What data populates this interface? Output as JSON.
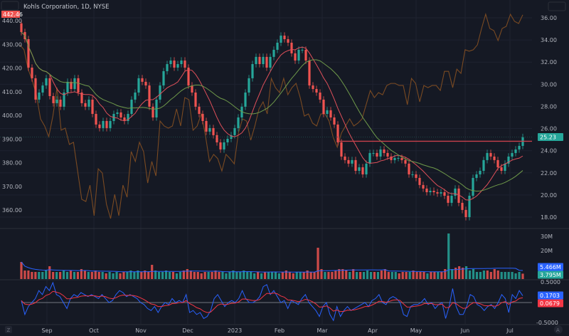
{
  "header": {
    "title": "Kohls Corporation, 1D, NYSE"
  },
  "colors": {
    "background": "#151924",
    "grid": "#1e2230",
    "up": "#26a69a",
    "down": "#ef5350",
    "ma_fast": "#e0505a",
    "ma_slow": "#6f9a4a",
    "compare": "#7a4a22",
    "resistance": "#c8414b",
    "vol_ma": "#2962ff",
    "osc_fast": "#2962ff",
    "osc_slow": "#f23645",
    "zero": "#9598a1"
  },
  "tags": {
    "compare_last": "442.46",
    "price_last": "25.23",
    "vol_ma_last": "5.466M",
    "vol_last": "3.795M",
    "osc_fast_last": "0.1703",
    "osc_slow_last": "0.0679"
  },
  "buttons": {
    "bottom_left": "Z",
    "bottom_right": "A"
  },
  "chart_data": {
    "type": "candlestick",
    "title": "Kohls Corporation, 1D, NYSE",
    "x_tick_labels": [
      "Sep",
      "Oct",
      "Nov",
      "Dec",
      "2023",
      "Feb",
      "Mar",
      "Apr",
      "May",
      "Jun",
      "Jul"
    ],
    "right_axis": {
      "ticks": [
        "36.00",
        "34.00",
        "32.00",
        "30.00",
        "28.00",
        "26.00",
        "24.00",
        "22.00",
        "20.00",
        "18.00"
      ],
      "range": [
        18,
        36
      ]
    },
    "left_axis": {
      "ticks": [
        "440.00",
        "430.00",
        "420.00",
        "410.00",
        "400.00",
        "390.00",
        "380.00",
        "370.00",
        "360.00"
      ],
      "range": [
        360,
        440
      ]
    },
    "closes": [
      34.71,
      34.07,
      31.5,
      30.54,
      28.61,
      29.25,
      29.89,
      30.54,
      28.93,
      28.29,
      28.61,
      27.97,
      29.25,
      30.22,
      29.57,
      30.54,
      29.25,
      28.29,
      27.97,
      28.61,
      27.32,
      26.36,
      26.04,
      26.68,
      26.04,
      26.68,
      27.32,
      27.45,
      27.0,
      26.68,
      27.32,
      28.61,
      29.25,
      30.54,
      30.22,
      29.89,
      27.97,
      27.0,
      28.61,
      29.89,
      31.18,
      31.82,
      32.14,
      31.5,
      31.82,
      32.14,
      31.5,
      29.89,
      29.25,
      27.97,
      27.32,
      26.68,
      25.72,
      26.04,
      25.4,
      24.75,
      24.11,
      24.75,
      25.07,
      25.4,
      26.04,
      27.0,
      27.97,
      29.25,
      30.54,
      31.82,
      32.47,
      31.82,
      32.47,
      31.5,
      32.47,
      33.11,
      33.75,
      34.39,
      34.07,
      33.75,
      32.79,
      32.14,
      33.11,
      33.11,
      32.14,
      29.89,
      29.57,
      29.25,
      28.61,
      27.32,
      27.65,
      27.0,
      26.36,
      24.75,
      23.47,
      23.15,
      22.83,
      23.15,
      22.18,
      22.5,
      21.86,
      22.83,
      23.79,
      23.79,
      23.47,
      24.11,
      23.79,
      23.47,
      23.15,
      23.34,
      23.34,
      23.15,
      22.83,
      21.86,
      21.86,
      21.54,
      20.9,
      20.58,
      20.25,
      20.38,
      20.25,
      20.13,
      20.25,
      19.93,
      19.29,
      19.93,
      20.58,
      19.29,
      18.65,
      18.0,
      19.93,
      21.54,
      21.86,
      22.18,
      23.15,
      23.79,
      23.47,
      23.15,
      22.5,
      22.18,
      22.83,
      23.47,
      23.79,
      24.11,
      24.43,
      25.23
    ],
    "resistance_level": 24.85,
    "compare_series": [
      429.8,
      427.7,
      419.5,
      414.7,
      408.7,
      398.5,
      395.5,
      391.0,
      399.7,
      411.7,
      393.7,
      394.6,
      387.7,
      388.6,
      376.5,
      364.5,
      363.6,
      370.5,
      357.6,
      377.4,
      375.6,
      362.4,
      356.4,
      366.6,
      357.6,
      370.5,
      365.4,
      384.7,
      380.5,
      388.6,
      384.7,
      371.4,
      380.5,
      374.4,
      397.6,
      395.5,
      394.6,
      395.5,
      402.7,
      395.5,
      407.5,
      406.6,
      393.7,
      395.5,
      400.6,
      391.6,
      380.5,
      383.5,
      381.7,
      376.5,
      383.5,
      381.7,
      379.5,
      392.5,
      398.5,
      397.6,
      389.5,
      395.5,
      402.7,
      405.7,
      400.6,
      415.6,
      411.7,
      409.6,
      415.6,
      408.7,
      411.7,
      413.5,
      407.5,
      399.7,
      400.6,
      396.7,
      395.5,
      400.6,
      400.6,
      397.6,
      390.7,
      386.5,
      392.5,
      395.5,
      398.5,
      395.5,
      396.7,
      398.5,
      404.5,
      410.5,
      407.5,
      409.6,
      408.7,
      412.6,
      413.5,
      413.5,
      412.6,
      412.6,
      404.5,
      415.6,
      413.5,
      405.7,
      412.6,
      411.7,
      412.6,
      412.6,
      410.5,
      418.6,
      418.6,
      411.7,
      419.5,
      417.7,
      427.7,
      427.1,
      427.7,
      429.8,
      436.7,
      442.7,
      436.7,
      435.8,
      431.6,
      436.7,
      437.6,
      442.7,
      439.7,
      438.8,
      442.46
    ],
    "volume": {
      "ticks": [
        "30M",
        "20M"
      ],
      "unit": "M",
      "values": [
        12,
        6,
        6,
        5,
        5,
        5,
        5,
        6,
        9,
        5,
        5,
        5,
        6,
        5,
        6,
        5,
        5,
        7,
        6,
        5,
        5,
        6,
        5,
        5,
        4,
        5,
        4,
        5,
        4,
        5,
        5,
        6,
        5,
        6,
        5,
        6,
        5,
        10,
        6,
        5,
        5,
        6,
        5,
        5,
        4,
        5,
        6,
        7,
        6,
        5,
        5,
        4,
        5,
        5,
        5,
        6,
        5,
        5,
        4,
        5,
        6,
        5,
        5,
        6,
        5,
        5,
        4,
        5,
        4,
        5,
        5,
        5,
        5,
        4,
        5,
        6,
        5,
        4,
        5,
        5,
        5,
        6,
        5,
        5,
        22,
        7,
        5,
        5,
        5,
        6,
        7,
        7,
        6,
        5,
        7,
        5,
        5,
        5,
        6,
        5,
        5,
        5,
        6,
        7,
        5,
        5,
        5,
        4,
        5,
        5,
        5,
        6,
        5,
        5,
        5,
        4,
        5,
        5,
        5,
        5,
        7,
        32,
        7,
        8,
        9,
        8,
        9,
        6,
        7,
        5,
        5,
        6,
        6,
        5,
        7,
        6,
        5,
        5,
        5,
        5,
        4,
        5,
        3.795
      ]
    },
    "oscillator": {
      "ticks": [
        "0.5000",
        "-0.5000"
      ],
      "range": [
        -0.5,
        0.5
      ],
      "values": [
        0.05,
        -0.3,
        -0.1,
        0.0,
        0.1,
        0.3,
        0.2,
        0.4,
        0.3,
        0.5,
        0.2,
        0.15,
        0.0,
        -0.15,
        0.1,
        0.2,
        0.15,
        0.25,
        0.2,
        0.15,
        0.2,
        0.15,
        0.1,
        0.2,
        0.1,
        0.0,
        0.05,
        0.2,
        0.3,
        0.25,
        0.15,
        0.2,
        0.15,
        0.1,
        0.0,
        -0.05,
        -0.15,
        -0.2,
        -0.1,
        -0.25,
        -0.1,
        0.0,
        -0.05,
        0.1,
        0.0,
        0.05,
        0.0,
        0.2,
        -0.25,
        -0.2,
        -0.3,
        -0.25,
        -0.4,
        -0.35,
        -0.2,
        0.1,
        0.2,
        0.05,
        -0.1,
        0.0,
        0.05,
        0.0,
        0.1,
        0.3,
        0.1,
        0.0,
        0.0,
        0.05,
        0.15,
        0.4,
        0.45,
        0.2,
        0.3,
        0.15,
        0.0,
        0.05,
        -0.15,
        0.05,
        0.0,
        -0.05,
        0.1,
        0.2,
        0.0,
        -0.1,
        -0.2,
        -0.35,
        -0.1,
        0.0,
        -0.3,
        -0.45,
        -0.1,
        -0.35,
        -0.2,
        -0.1,
        -0.2,
        -0.15,
        -0.1,
        -0.05,
        0.0,
        -0.1,
        0.05,
        0.1,
        0.2,
        0.0,
        -0.05,
        0.1,
        0.15,
        0.1,
        0.0,
        -0.3,
        -0.35,
        -0.1,
        -0.05,
        -0.05,
        0.0,
        0.1,
        -0.05,
        0.0,
        -0.15,
        -0.05,
        0.0,
        -0.4,
        -0.1,
        0.35,
        -0.1,
        -0.3,
        -0.3,
        -0.1,
        0.2,
        0.15,
        -0.05,
        -0.1,
        -0.2,
        -0.1,
        -0.05,
        -0.15,
        0.0,
        0.2,
        0.1,
        -0.25,
        0.2,
        0.1,
        0.3,
        0.1703
      ]
    }
  }
}
